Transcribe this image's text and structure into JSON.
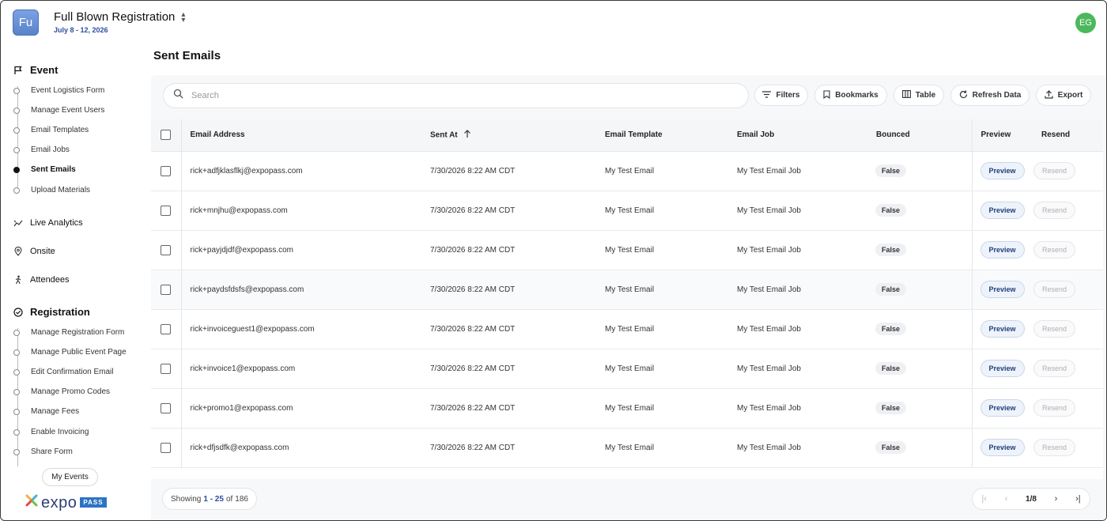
{
  "header": {
    "app_logo_text": "Fu",
    "event_name": "Full Blown Registration",
    "event_dates": "July 8 - 12, 2026",
    "user_initials": "EG"
  },
  "sidebar": {
    "event_section": {
      "label": "Event",
      "items": [
        {
          "label": "Event Logistics Form",
          "active": false
        },
        {
          "label": "Manage Event Users",
          "active": false
        },
        {
          "label": "Email Templates",
          "active": false
        },
        {
          "label": "Email Jobs",
          "active": false
        },
        {
          "label": "Sent Emails",
          "active": true
        },
        {
          "label": "Upload Materials",
          "active": false
        }
      ]
    },
    "live_analytics": "Live Analytics",
    "onsite": "Onsite",
    "attendees": "Attendees",
    "registration_section": {
      "label": "Registration",
      "items": [
        {
          "label": "Manage Registration Form"
        },
        {
          "label": "Manage Public Event Page"
        },
        {
          "label": "Edit Confirmation Email"
        },
        {
          "label": "Manage Promo Codes"
        },
        {
          "label": "Manage Fees"
        },
        {
          "label": "Enable Invoicing"
        },
        {
          "label": "Share Form"
        }
      ]
    },
    "my_events_label": "My Events",
    "brand_word": "expo",
    "brand_badge": "PASS"
  },
  "main": {
    "title": "Sent Emails",
    "search_placeholder": "Search",
    "toolbar": {
      "filters": "Filters",
      "bookmarks": "Bookmarks",
      "table": "Table",
      "refresh": "Refresh Data",
      "export": "Export"
    },
    "table": {
      "columns": {
        "email": "Email Address",
        "sent_at": "Sent At",
        "template": "Email Template",
        "job": "Email Job",
        "bounced": "Bounced",
        "preview": "Preview",
        "resend": "Resend"
      },
      "preview_label": "Preview",
      "resend_label": "Resend",
      "rows": [
        {
          "email": "rick+adfjklasflkj@expopass.com",
          "sent_at": "7/30/2026 8:22 AM CDT",
          "template": "My Test Email",
          "job": "My Test Email Job",
          "bounced": "False"
        },
        {
          "email": "rick+mnjhu@expopass.com",
          "sent_at": "7/30/2026 8:22 AM CDT",
          "template": "My Test Email",
          "job": "My Test Email Job",
          "bounced": "False"
        },
        {
          "email": "rick+payjdjdf@expopass.com",
          "sent_at": "7/30/2026 8:22 AM CDT",
          "template": "My Test Email",
          "job": "My Test Email Job",
          "bounced": "False"
        },
        {
          "email": "rick+paydsfdsfs@expopass.com",
          "sent_at": "7/30/2026 8:22 AM CDT",
          "template": "My Test Email",
          "job": "My Test Email Job",
          "bounced": "False"
        },
        {
          "email": "rick+invoiceguest1@expopass.com",
          "sent_at": "7/30/2026 8:22 AM CDT",
          "template": "My Test Email",
          "job": "My Test Email Job",
          "bounced": "False"
        },
        {
          "email": "rick+invoice1@expopass.com",
          "sent_at": "7/30/2026 8:22 AM CDT",
          "template": "My Test Email",
          "job": "My Test Email Job",
          "bounced": "False"
        },
        {
          "email": "rick+promo1@expopass.com",
          "sent_at": "7/30/2026 8:22 AM CDT",
          "template": "My Test Email",
          "job": "My Test Email Job",
          "bounced": "False"
        },
        {
          "email": "rick+dfjsdfk@expopass.com",
          "sent_at": "7/30/2026 8:22 AM CDT",
          "template": "My Test Email",
          "job": "My Test Email Job",
          "bounced": "False"
        }
      ]
    },
    "footer": {
      "showing_prefix": "Showing",
      "range": "1 - 25",
      "of_label": "of",
      "total": "186",
      "page": "1/8"
    }
  }
}
